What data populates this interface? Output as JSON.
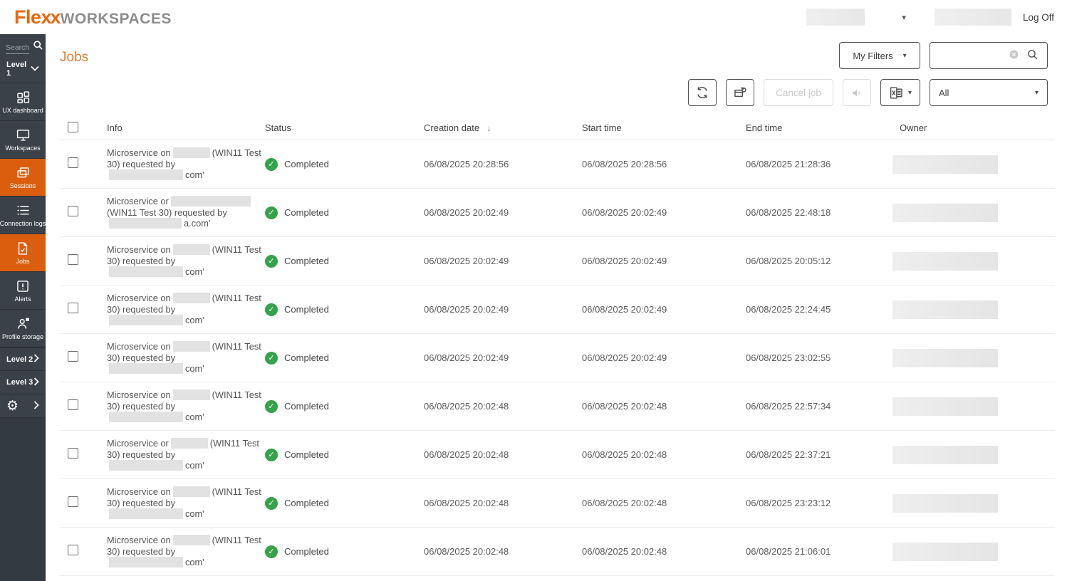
{
  "brand": {
    "logo_part1": "Fle",
    "logo_part2": "xx",
    "logo_part3": "WORKSPACES",
    "accent_orange": "#db5e0f",
    "logo_orange": "#e8680f",
    "logo_gray": "#8d8d8d"
  },
  "icons": {
    "caret_down": "▾",
    "sort_desc": "↓",
    "check": "✓",
    "gear": "⚙"
  },
  "header": {
    "log_off_label": "Log Off"
  },
  "sidebar": {
    "search_placeholder": "Search",
    "level1_label": "Level 1",
    "items": [
      {
        "label": "UX dashboard",
        "icon": "dashboard",
        "active": false
      },
      {
        "label": "Workspaces",
        "icon": "monitor",
        "active": false
      },
      {
        "label": "Sessions",
        "icon": "windows",
        "active": true
      },
      {
        "label": "Connection logs",
        "icon": "list",
        "active": false
      },
      {
        "label": "Jobs",
        "icon": "doc-check",
        "active": true
      },
      {
        "label": "Alerts",
        "icon": "alert",
        "active": false
      },
      {
        "label": "Profile storage",
        "icon": "profile",
        "active": false
      }
    ],
    "level2_label": "Level 2",
    "level3_label": "Level 3"
  },
  "page": {
    "title": "Jobs"
  },
  "controls": {
    "my_filters_label": "My Filters",
    "search_value": "",
    "cancel_job_label": "Cancel job",
    "filter_all_value": "All"
  },
  "table": {
    "columns": {
      "info": "Info",
      "status": "Status",
      "creation_date": "Creation date",
      "start_time": "Start time",
      "end_time": "End time",
      "owner": "Owner"
    },
    "sort": {
      "column": "Creation date",
      "direction": "descending"
    },
    "status_green": "#36a24a",
    "rows": [
      {
        "status": "Completed",
        "creation_date": "06/08/2025 20:28:56",
        "start_time": "06/08/2025 20:28:56",
        "end_time": "06/08/2025 21:28:36",
        "info_lines": [
          [
            {
              "t": "Microservice on"
            },
            {
              "r": 52
            },
            {
              "t": "(WIN11 Test"
            }
          ],
          [
            {
              "t": "30) requested by"
            }
          ],
          [
            {
              "r": 104
            },
            {
              "t": "com'"
            }
          ]
        ]
      },
      {
        "status": "Completed",
        "creation_date": "06/08/2025 20:02:49",
        "start_time": "06/08/2025 20:02:49",
        "end_time": "06/08/2025 22:48:18",
        "info_lines": [
          [
            {
              "t": "Microservice or"
            },
            {
              "r": 112
            }
          ],
          [
            {
              "t": "(WIN11 Test 30) requested by"
            }
          ],
          [
            {
              "r": 102
            },
            {
              "t": "a.com'"
            }
          ]
        ]
      },
      {
        "status": "Completed",
        "creation_date": "06/08/2025 20:02:49",
        "start_time": "06/08/2025 20:02:49",
        "end_time": "06/08/2025 20:05:12",
        "info_lines": [
          [
            {
              "t": "Microservice on"
            },
            {
              "r": 52
            },
            {
              "t": "(WIN11 Test"
            }
          ],
          [
            {
              "t": "30) requested by"
            }
          ],
          [
            {
              "r": 104
            },
            {
              "t": "com'"
            }
          ]
        ]
      },
      {
        "status": "Completed",
        "creation_date": "06/08/2025 20:02:49",
        "start_time": "06/08/2025 20:02:49",
        "end_time": "06/08/2025 22:24:45",
        "info_lines": [
          [
            {
              "t": "Microservice on"
            },
            {
              "r": 52
            },
            {
              "t": "(WIN11 Test"
            }
          ],
          [
            {
              "t": "30) requested by"
            }
          ],
          [
            {
              "r": 104
            },
            {
              "t": "com'"
            }
          ]
        ]
      },
      {
        "status": "Completed",
        "creation_date": "06/08/2025 20:02:49",
        "start_time": "06/08/2025 20:02:49",
        "end_time": "06/08/2025 23:02:55",
        "info_lines": [
          [
            {
              "t": "Microservice on"
            },
            {
              "r": 52
            },
            {
              "t": "(WIN11 Test"
            }
          ],
          [
            {
              "t": "30) requested by"
            }
          ],
          [
            {
              "r": 104
            },
            {
              "t": "com'"
            }
          ]
        ]
      },
      {
        "status": "Completed",
        "creation_date": "06/08/2025 20:02:48",
        "start_time": "06/08/2025 20:02:48",
        "end_time": "06/08/2025 22:57:34",
        "info_lines": [
          [
            {
              "t": "Microservice on"
            },
            {
              "r": 52
            },
            {
              "t": "(WIN11 Test"
            }
          ],
          [
            {
              "t": "30) requested by"
            }
          ],
          [
            {
              "r": 104
            },
            {
              "t": "com'"
            }
          ]
        ]
      },
      {
        "status": "Completed",
        "creation_date": "06/08/2025 20:02:48",
        "start_time": "06/08/2025 20:02:48",
        "end_time": "06/08/2025 22:37:21",
        "info_lines": [
          [
            {
              "t": "Microservice or"
            },
            {
              "r": 52
            },
            {
              "t": "(WIN11 Test"
            }
          ],
          [
            {
              "t": "30) requested by"
            }
          ],
          [
            {
              "r": 104
            },
            {
              "t": "com'"
            }
          ]
        ]
      },
      {
        "status": "Completed",
        "creation_date": "06/08/2025 20:02:48",
        "start_time": "06/08/2025 20:02:48",
        "end_time": "06/08/2025 23:23:12",
        "info_lines": [
          [
            {
              "t": "Microservice on"
            },
            {
              "r": 52
            },
            {
              "t": "(WIN11 Test"
            }
          ],
          [
            {
              "t": "30) requested by"
            }
          ],
          [
            {
              "r": 104
            },
            {
              "t": "com'"
            }
          ]
        ]
      },
      {
        "status": "Completed",
        "creation_date": "06/08/2025 20:02:48",
        "start_time": "06/08/2025 20:02:48",
        "end_time": "06/08/2025 21:06:01",
        "info_lines": [
          [
            {
              "t": "Microservice on"
            },
            {
              "r": 52
            },
            {
              "t": "(WIN11 Test"
            }
          ],
          [
            {
              "t": "30) requested by"
            }
          ],
          [
            {
              "r": 104
            },
            {
              "t": "com'"
            }
          ]
        ]
      }
    ]
  }
}
